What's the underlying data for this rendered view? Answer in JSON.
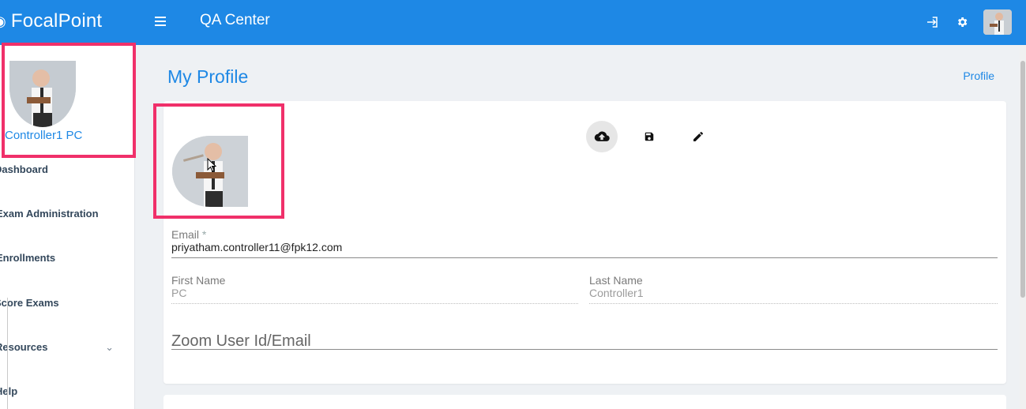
{
  "brand": {
    "name": "FocalPoint"
  },
  "header": {
    "title": "QA Center"
  },
  "user": {
    "name": "Controller1 PC"
  },
  "sidebar": {
    "items": [
      {
        "label": "Dashboard"
      },
      {
        "label": "Exam Administration"
      },
      {
        "label": "Enrollments"
      },
      {
        "label": "Score Exams"
      },
      {
        "label": "Resources"
      },
      {
        "label": "Help"
      }
    ]
  },
  "page": {
    "title": "My Profile",
    "breadcrumb": "Profile"
  },
  "form": {
    "email": {
      "label": "Email",
      "required_mark": "*",
      "value": "priyatham.controller11@fpk12.com"
    },
    "first_name": {
      "label": "First Name",
      "value": "PC"
    },
    "last_name": {
      "label": "Last Name",
      "value": "Controller1"
    },
    "zoom": {
      "label": "Zoom User Id/Email"
    }
  },
  "icons": {
    "brand": "brand-icon",
    "menu": "hamburger-icon",
    "logout": "logout-icon",
    "settings": "gear-icon",
    "upload": "cloud-upload-icon",
    "save": "save-icon",
    "edit": "pencil-icon",
    "expand": "chevron-down-icon"
  },
  "colors": {
    "primary": "#1e88e5",
    "highlight": "#f0306a"
  }
}
